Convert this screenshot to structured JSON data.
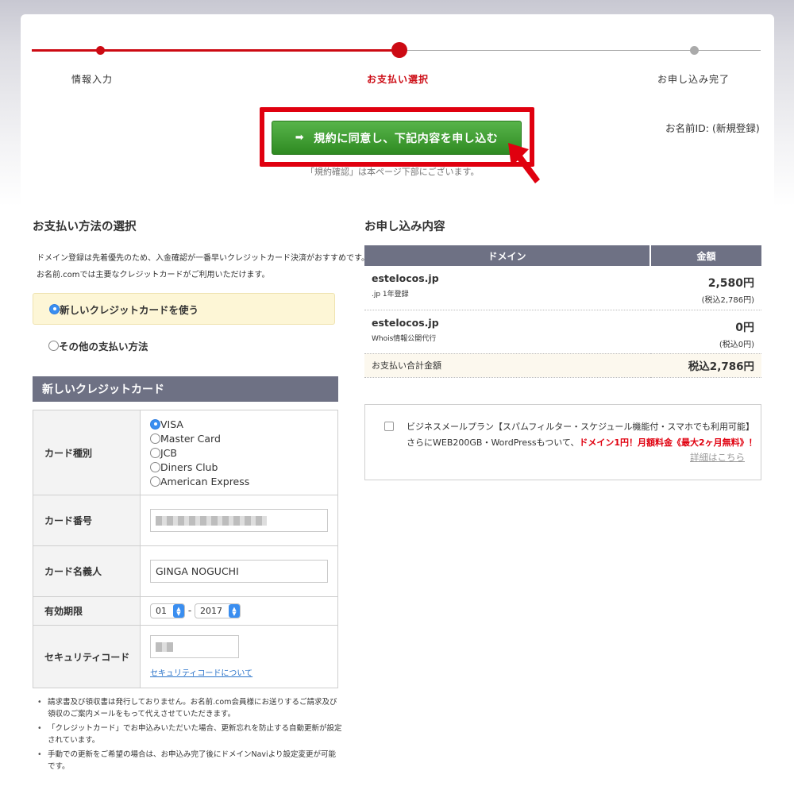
{
  "progress": {
    "steps": [
      "情報入力",
      "お支払い選択",
      "お申し込み完了"
    ],
    "current_step": 2
  },
  "name_id": "お名前ID: (新規登録)",
  "agree_button": {
    "arrow": "➡",
    "label": "規約に同意し、下記内容を申し込む"
  },
  "agree_note": "「規約確認」は本ページ下部にございます。",
  "payment": {
    "title": "お支払い方法の選択",
    "description": "ドメイン登録は先着優先のため、入金確認が一番早いクレジットカード決済がおすすめです。お名前.comでは主要なクレジットカードがご利用いただけます。",
    "options": [
      "新しいクレジットカードを使う",
      "その他の支払い方法"
    ],
    "selected": 0
  },
  "credit_card": {
    "title": "新しいクレジットカード",
    "labels": {
      "type": "カード種別",
      "number": "カード番号",
      "holder": "カード名義人",
      "expiry": "有効期限",
      "security": "セキュリティコード"
    },
    "brands": [
      "VISA",
      "Master Card",
      "JCB",
      "Diners Club",
      "American Express"
    ],
    "selected_brand": "VISA",
    "holder_value": "GINGA NOGUCHI",
    "expiry_month": "01",
    "expiry_sep": "-",
    "expiry_year": "2017",
    "security_link": "セキュリティコードについて"
  },
  "notes": [
    "請求書及び領収書は発行しておりません。お名前.com会員様にお送りするご請求及び領収のご案内メールをもって代えさせていただきます。",
    "「クレジットカード」でお申込みいただいた場合、更新忘れを防止する自動更新が設定されています。",
    "手動での更新をご希望の場合は、お申込み完了後にドメインNaviより設定変更が可能です。"
  ],
  "order": {
    "title": "お申し込み内容",
    "headers": [
      "ドメイン",
      "金額"
    ],
    "rows": [
      {
        "name": "estelocos.jp",
        "sub": ".jp 1年登録",
        "price": "2,580円",
        "tax": "(税込2,786円)"
      },
      {
        "name": "estelocos.jp",
        "sub": "Whois情報公開代行",
        "price": "0円",
        "tax": "(税込0円)"
      }
    ],
    "total_label": "お支払い合計金額",
    "total_value": "税込2,786円"
  },
  "business_mail": {
    "line1": "ビジネスメールプラン【スパムフィルター・スケジュール機能付・スマホでも利用可能】",
    "line2_prefix": "さらにWEB200GB・WordPressもついて、",
    "line2_red": "ドメイン1円！月額料金《最大2ヶ月無料》！",
    "link": "詳細はこちら"
  },
  "colors": {
    "accent_red": "#cc0a13",
    "button_green": "#3a9a2e",
    "header_slate": "#6e7184",
    "radio_blue": "#3a8ef0"
  }
}
